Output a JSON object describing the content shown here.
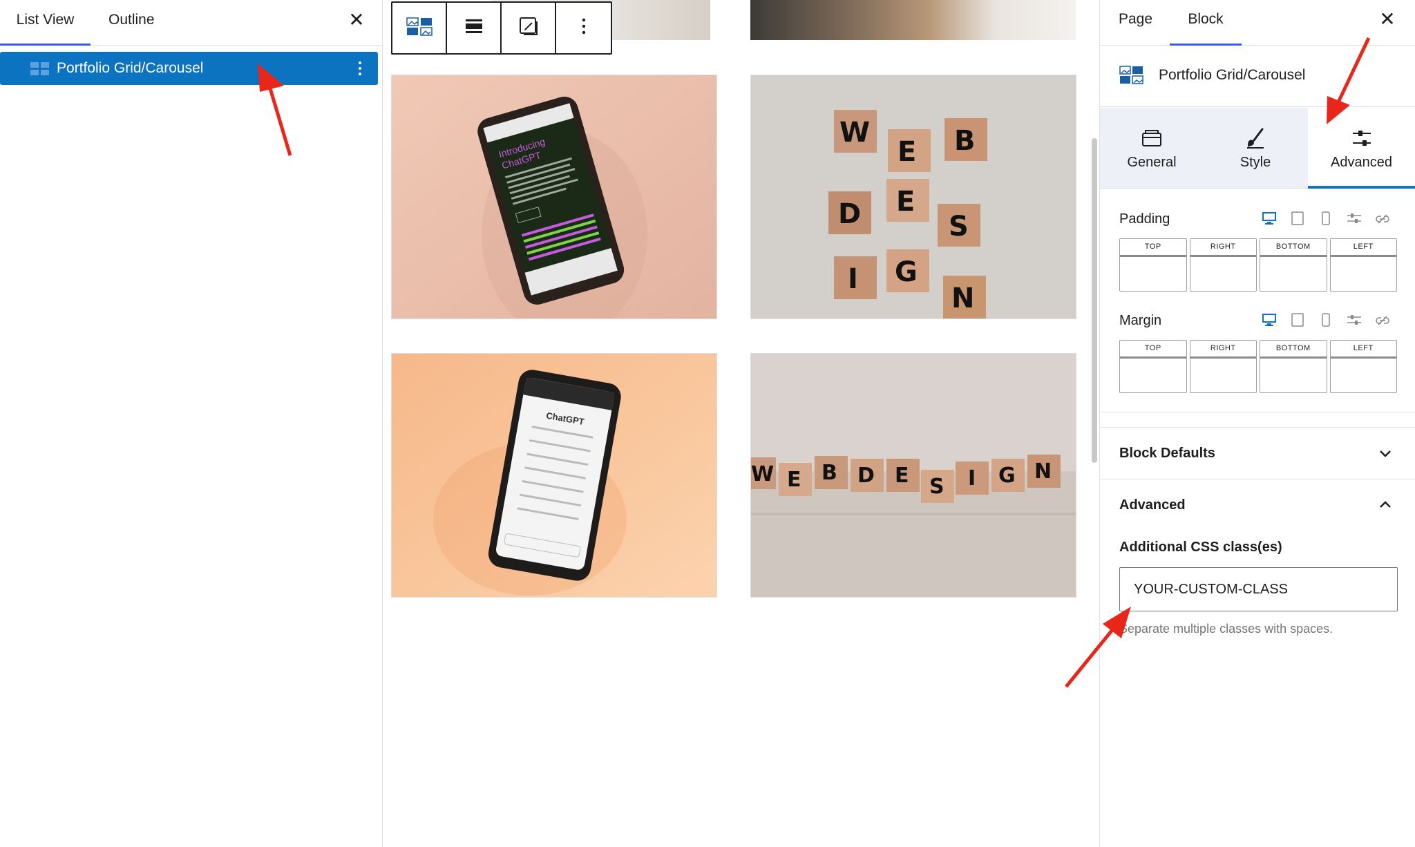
{
  "left_panel": {
    "tabs": [
      {
        "label": "List View"
      },
      {
        "label": "Outline"
      }
    ],
    "close_symbol": "✕",
    "items": [
      {
        "label": "Portfolio Grid/Carousel",
        "icon": "portfolio-block-icon"
      }
    ]
  },
  "canvas": {
    "toolbar": [
      {
        "icon": "block-type-icon"
      },
      {
        "icon": "align-icon"
      },
      {
        "icon": "edit-image-icon"
      },
      {
        "icon": "more-options-icon"
      }
    ],
    "tiles": [
      {
        "alt": "Phone on peach background"
      },
      {
        "alt": "Wooden blocks"
      },
      {
        "alt": "Phone on orange background"
      },
      {
        "alt": "Wooden blocks on a table"
      }
    ]
  },
  "right_panel": {
    "tabs": [
      {
        "label": "Page"
      },
      {
        "label": "Block"
      }
    ],
    "close_symbol": "✕",
    "block_title": "Portfolio Grid/Carousel",
    "subtabs": [
      {
        "label": "General",
        "icon": "general-icon"
      },
      {
        "label": "Style",
        "icon": "brush-icon"
      },
      {
        "label": "Advanced",
        "icon": "sliders-icon",
        "active": true
      }
    ],
    "padding": {
      "label": "Padding",
      "sides": [
        "TOP",
        "RIGHT",
        "BOTTOM",
        "LEFT"
      ]
    },
    "margin": {
      "label": "Margin",
      "sides": [
        "TOP",
        "RIGHT",
        "BOTTOM",
        "LEFT"
      ]
    },
    "block_defaults": {
      "label": "Block Defaults"
    },
    "advanced": {
      "label": "Advanced",
      "css_label": "Additional CSS class(es)",
      "css_value": "YOUR-CUSTOM-CLASS",
      "help": "Separate multiple classes with spaces."
    }
  },
  "colors": {
    "accent": "#0b73c0",
    "tab_underline": "#3858e9",
    "arrow": "#e8261a"
  }
}
